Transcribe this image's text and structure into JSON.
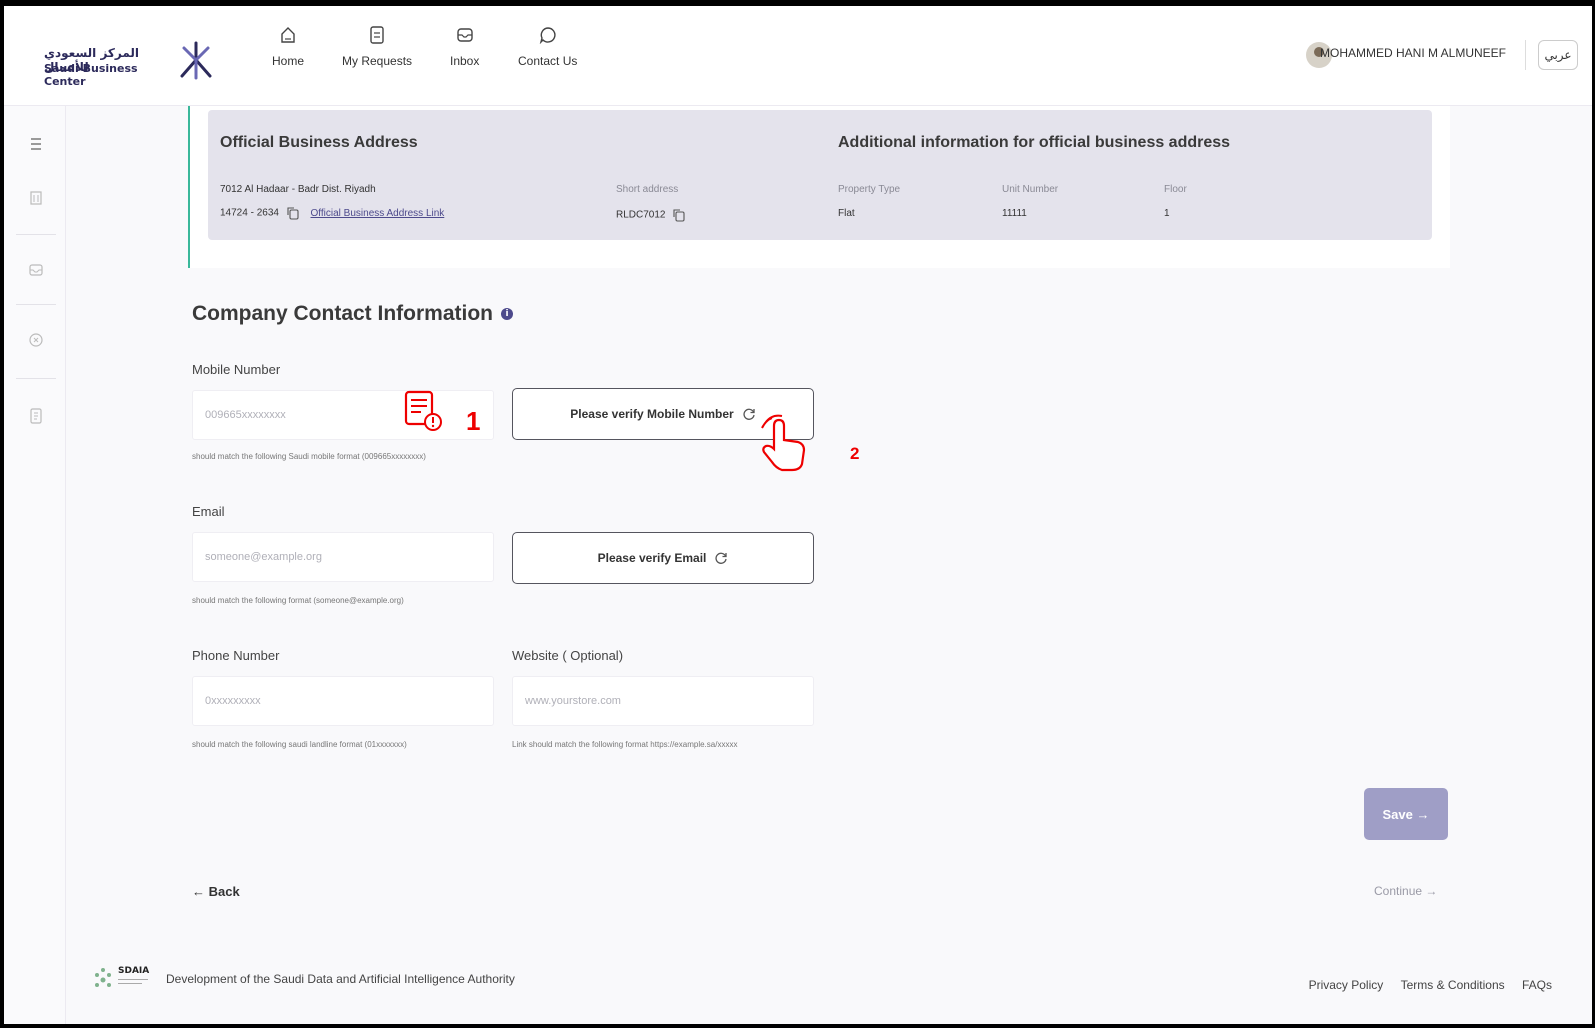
{
  "brand": {
    "name_ar": "المركز السعودي للأعمال",
    "name_en": "Saudi Business Center"
  },
  "nav": [
    {
      "label": "Home",
      "icon": "home-icon"
    },
    {
      "label": "My Requests",
      "icon": "document-icon"
    },
    {
      "label": "Inbox",
      "icon": "inbox-icon"
    },
    {
      "label": "Contact Us",
      "icon": "chat-icon"
    }
  ],
  "user": {
    "name": "MOHAMMED HANI M ALMUNEEF"
  },
  "language_toggle": "عربي",
  "address": {
    "title": "Official Business Address",
    "line1": "7012 Al Hadaar - Badr Dist. Riyadh",
    "line2": "14724 - 2634",
    "link_label": "Official Business Address Link",
    "short_address_label": "Short address",
    "short_address_value": "RLDC7012"
  },
  "additional": {
    "title": "Additional information for official business address",
    "property_type_label": "Property Type",
    "property_type_value": "Flat",
    "unit_number_label": "Unit Number",
    "unit_number_value": "11111",
    "floor_label": "Floor",
    "floor_value": "1"
  },
  "contact": {
    "title": "Company Contact Information",
    "mobile": {
      "label": "Mobile Number",
      "placeholder": "009665xxxxxxxx",
      "hint": "should match the following Saudi mobile format (009665xxxxxxxx)",
      "verify_label": "Please verify Mobile Number"
    },
    "email": {
      "label": "Email",
      "placeholder": "someone@example.org",
      "hint": "should match the following format (someone@example.org)",
      "verify_label": "Please verify Email"
    },
    "phone": {
      "label": "Phone Number",
      "placeholder": "0xxxxxxxxx",
      "hint": "should match the following saudi landline format (01xxxxxxx)"
    },
    "website": {
      "label": "Website ( Optional)",
      "placeholder": "www.yourstore.com",
      "hint": "Link should match the following format https://example.sa/xxxxx"
    }
  },
  "annotations": {
    "step1": "1",
    "step2": "2"
  },
  "actions": {
    "save": "Save →",
    "back": "← Back",
    "continue": "Continue →"
  },
  "footer": {
    "sdaia": "SDAIA",
    "text": "Development of the Saudi Data and Artificial Intelligence Authority",
    "links": [
      "Privacy Policy",
      "Terms & Conditions",
      "FAQs"
    ]
  },
  "colors": {
    "primary": "#4d4a8c",
    "accent_green": "#3ab89a",
    "save_disabled": "#9f9ec6",
    "annotation_red": "#e00000"
  }
}
